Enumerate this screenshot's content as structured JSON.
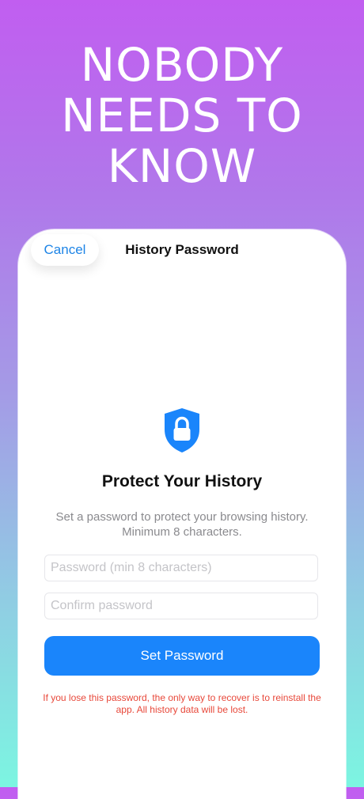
{
  "headline": {
    "line1": "NOBODY",
    "line2": "NEEDS TO",
    "line3": "KNOW"
  },
  "nav": {
    "cancel_label": "Cancel",
    "title": "History Password"
  },
  "content": {
    "icon": "shield-lock-icon",
    "heading": "Protect Your History",
    "description": "Set a password to protect your browsing history. Minimum 8 characters.",
    "password_placeholder": "Password (min 8 characters)",
    "password_value": "",
    "confirm_placeholder": "Confirm password",
    "confirm_value": "",
    "set_button_label": "Set Password",
    "warning": "If you lose this password, the only way to recover is to reinstall the app. All history data will be lost."
  },
  "colors": {
    "accent": "#1a85fb",
    "link": "#1d84e6",
    "warning": "#e8483a",
    "gradient_top": "#c15ef0",
    "gradient_bottom": "#7cf5e1"
  }
}
